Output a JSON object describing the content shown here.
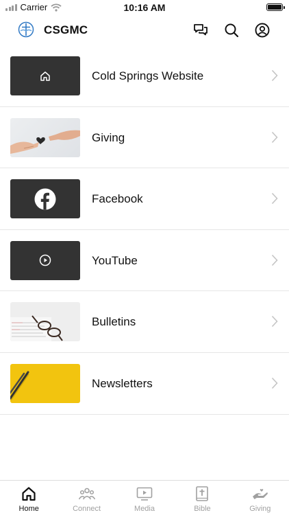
{
  "status_bar": {
    "carrier": "Carrier",
    "time": "10:16 AM"
  },
  "header": {
    "title": "CSGMC"
  },
  "list": {
    "items": [
      {
        "label": "Cold Springs Website",
        "thumb": "home-icon"
      },
      {
        "label": "Giving",
        "thumb": "giving-photo"
      },
      {
        "label": "Facebook",
        "thumb": "facebook-icon"
      },
      {
        "label": "YouTube",
        "thumb": "play-circle-icon"
      },
      {
        "label": "Bulletins",
        "thumb": "bulletins-photo"
      },
      {
        "label": "Newsletters",
        "thumb": "newsletters-photo"
      }
    ]
  },
  "tabs": [
    {
      "label": "Home",
      "icon": "home-icon",
      "active": true
    },
    {
      "label": "Connect",
      "icon": "people-icon",
      "active": false
    },
    {
      "label": "Media",
      "icon": "media-icon",
      "active": false
    },
    {
      "label": "Bible",
      "icon": "bible-icon",
      "active": false
    },
    {
      "label": "Giving",
      "icon": "giving-icon",
      "active": false
    }
  ],
  "colors": {
    "thumb_dark": "#333333",
    "tab_active": "#111111",
    "tab_inactive": "#a0a0a0",
    "logo_blue": "#2f78c4"
  }
}
